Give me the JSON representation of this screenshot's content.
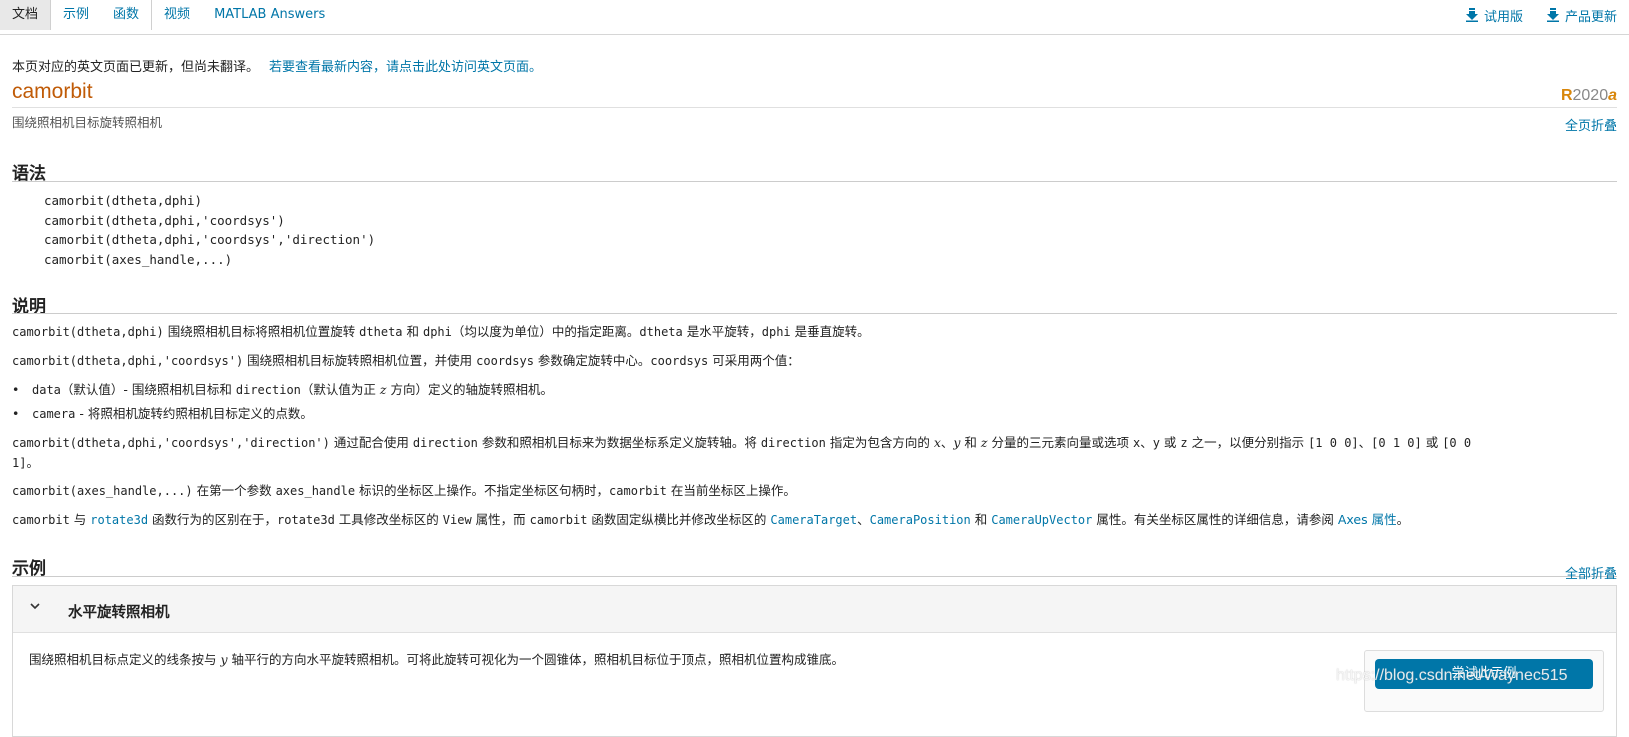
{
  "nav": {
    "tabs": [
      "文档",
      "示例",
      "函数",
      "视频",
      "MATLAB Answers"
    ],
    "right_links": [
      "试用版",
      "产品更新"
    ]
  },
  "notice": {
    "text": "本页对应的英文页面已更新，但尚未翻译。",
    "link": "若要查看最新内容，请点击此处访问英文页面。"
  },
  "title": "camorbit",
  "release": {
    "r": "R",
    "year": "2020",
    "suffix": "a"
  },
  "subtitle": "围绕照相机目标旋转照相机",
  "collapse_page": "全页折叠",
  "syntax": {
    "heading": "语法",
    "lines": [
      "camorbit(dtheta,dphi)",
      "camorbit(dtheta,dphi,'coordsys')",
      "camorbit(dtheta,dphi,'coordsys','direction')",
      "camorbit(axes_handle,...)"
    ]
  },
  "description": {
    "heading": "说明",
    "p1": {
      "code": "camorbit(dtheta,dphi)",
      "t1": " 围绕照相机目标将照相机位置旋转 ",
      "c1": "dtheta",
      "t2": " 和 ",
      "c2": "dphi",
      "t3": "（均以度为单位）中的指定距离。",
      "c3": "dtheta",
      "t4": " 是水平旋转，",
      "c4": "dphi",
      "t5": " 是垂直旋转。"
    },
    "p2": {
      "code": "camorbit(dtheta,dphi,'coordsys')",
      "t1": " 围绕照相机目标旋转照相机位置，并使用 ",
      "c1": "coordsys",
      "t2": " 参数确定旋转中心。",
      "c2": "coordsys",
      "t3": " 可采用两个值："
    },
    "b1": {
      "code": "data",
      "t1": "（默认值）- 围绕照相机目标和 ",
      "c1": "direction",
      "t2": "（默认值为正 ",
      "italic": "z",
      "t3": " 方向）定义的轴旋转照相机。"
    },
    "b2": {
      "code": "camera",
      "t1": " - 将照相机旋转约照相机目标定义的点数。"
    },
    "p3": {
      "code": "camorbit(dtheta,dphi,'coordsys','direction')",
      "t1": " 通过配合使用 ",
      "c1": "direction",
      "t2": " 参数和照相机目标来为数据坐标系定义旋转轴。将 ",
      "c2": "direction",
      "t3": " 指定为包含方向的 ",
      "x": "x",
      "sep1": "、",
      "y": "y",
      "t4": " 和 ",
      "z": "z",
      "t5": " 分量的三元素向量或选项 ",
      "c3": "x",
      "t6": "、",
      "c4": "y",
      "t7": " 或 ",
      "c5": "z",
      "t8": " 之一，以便分别指示 ",
      "c6": "[1 0 0]",
      "t9": "、",
      "c7": "[0 1 0]",
      "t10": " 或 ",
      "c8a": "[0 0",
      "c8b": "1]",
      "t11": "。"
    },
    "p4": {
      "code": "camorbit(axes_handle,...)",
      "t1": " 在第一个参数 ",
      "c1": "axes_handle",
      "t2": " 标识的坐标区上操作。不指定坐标区句柄时，",
      "c2": "camorbit",
      "t3": " 在当前坐标区上操作。"
    },
    "p5": {
      "code": "camorbit",
      "t1": " 与 ",
      "l1": "rotate3d",
      "t2": " 函数行为的区别在于，",
      "c1": "rotate3d",
      "t3": " 工具修改坐标区的 ",
      "c2": "View",
      "t4": " 属性，而 ",
      "c3": "camorbit",
      "t5": " 函数固定纵横比并修改坐标区的 ",
      "l2": "CameraTarget",
      "t6": "、",
      "l3": "CameraPosition",
      "t7": " 和 ",
      "l4": "CameraUpVector",
      "t8": " 属性。有关坐标区属性的详细信息，请参阅 ",
      "l5": "Axes 属性",
      "t9": "。"
    }
  },
  "examples": {
    "heading": "示例",
    "collapse_all": "全部折叠",
    "item": {
      "title": "水平旋转照相机",
      "text_a": "围绕照相机目标点定义的线条按与 ",
      "italic": "y",
      "text_b": " 轴平行的方向水平旋转照相机。可将此旋转可视化为一个圆锥体，照相机目标位于顶点，照相机位置构成锥底。",
      "button": "尝试此示例"
    }
  },
  "watermark": "https://blog.csdn.net/Waynec515"
}
